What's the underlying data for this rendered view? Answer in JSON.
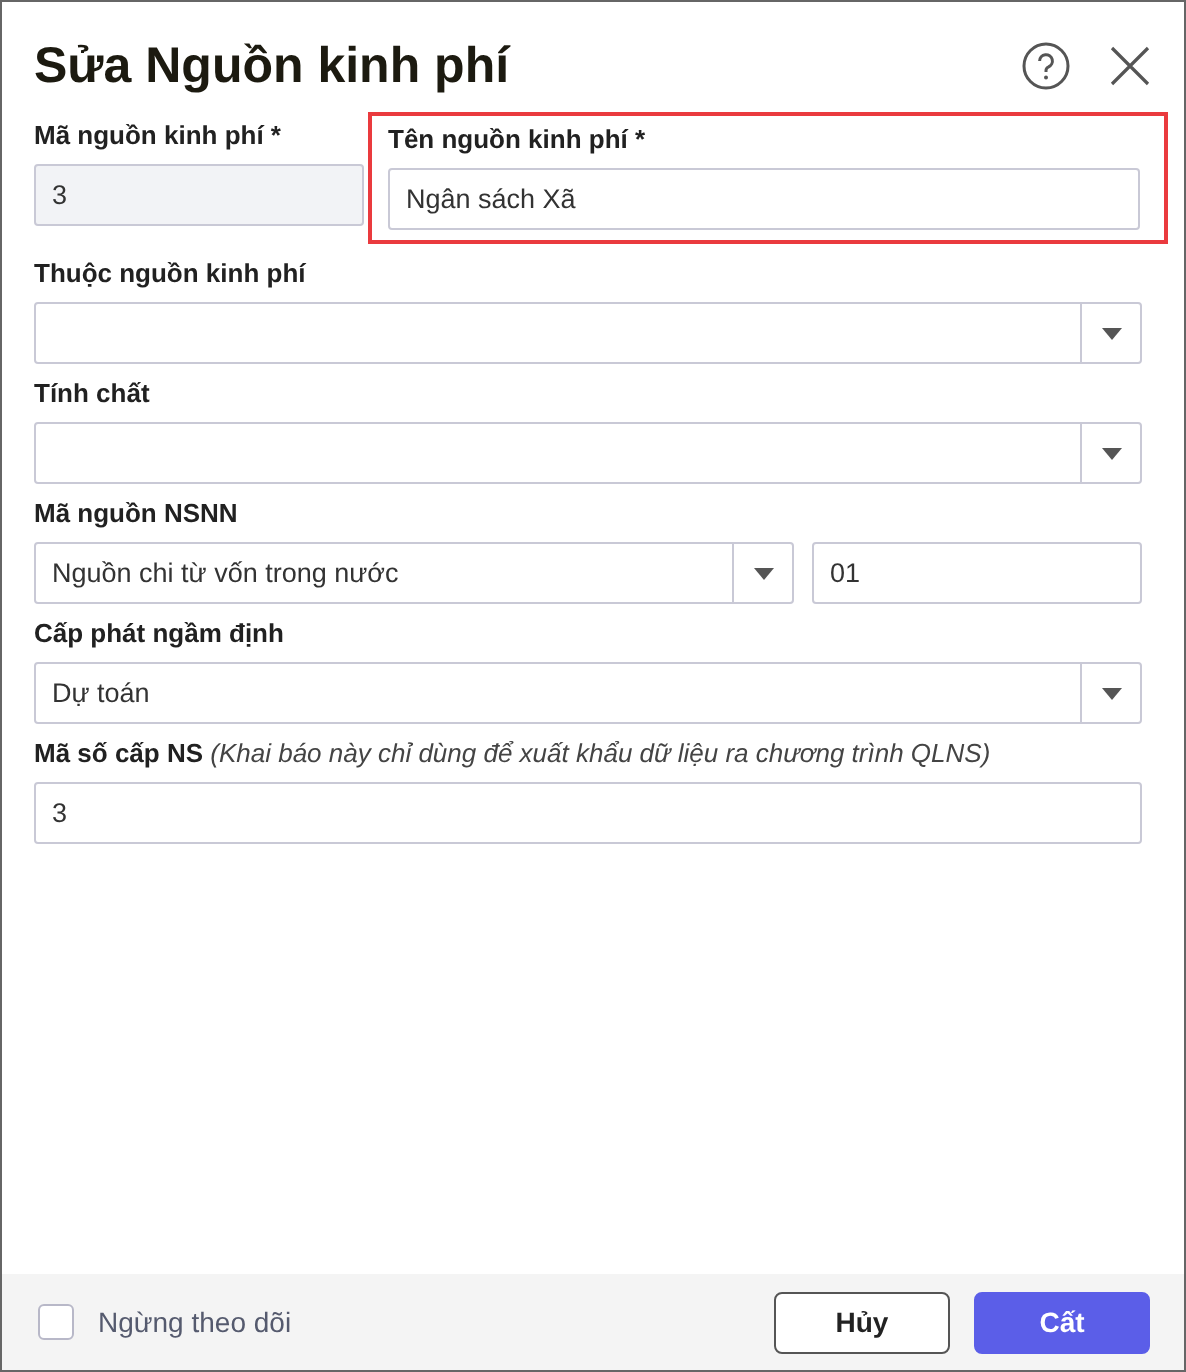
{
  "dialog": {
    "title": "Sửa Nguồn kinh phí"
  },
  "code_field": {
    "label": "Mã nguồn kinh phí *",
    "value": "3",
    "disabled": true
  },
  "name_field": {
    "label": "Tên nguồn kinh phí *",
    "value": "Ngân sách Xã",
    "highlighted": true
  },
  "fields": [
    {
      "kind": "select",
      "label": "Thuộc nguồn kinh phí"
    },
    {
      "kind": "select",
      "label": "Tính chất"
    },
    {
      "kind": "select_code",
      "label": "Mã nguồn NSNN",
      "value": "Nguồn chi từ vốn trong nước",
      "code": "01"
    },
    {
      "kind": "select",
      "label": "Cấp phát ngầm định",
      "value": "Dự toán"
    },
    {
      "kind": "text",
      "label": "Mã số cấp NS *(Khai báo này chỉ dùng để xuất khẩu dữ liệu ra chương trình QLNS)*",
      "value": "3"
    }
  ],
  "footer": {
    "checkbox": {
      "label": "Ngừng theo dõi",
      "checked": false
    },
    "buttons": [
      {
        "label": "Hủy",
        "kind": "secondary"
      },
      {
        "label": "Cất",
        "kind": "primary"
      }
    ]
  }
}
